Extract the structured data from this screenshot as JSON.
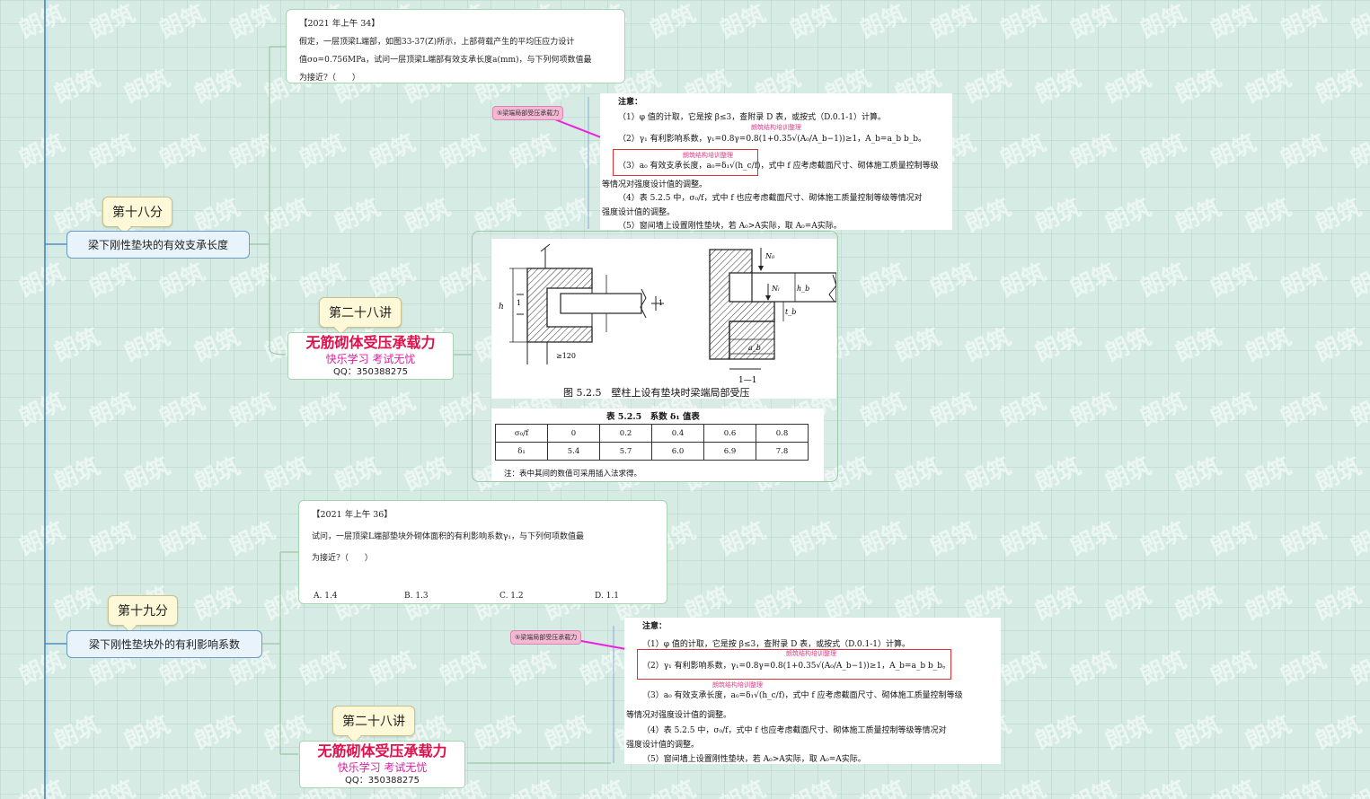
{
  "watermark": {
    "text": "朗筑"
  },
  "topics": [
    {
      "score_tag": "第十八分",
      "title": "梁下刚性垫块的有效支承长度",
      "question": {
        "header": "【2021 年上午 34】",
        "lines": [
          "假定，一层顶梁L端部，如图33-37(Z)所示，上部荷载产生的平均压应力设计",
          "值σo=0.756MPa，试问一层顶梁L端部有效支承长度a(mm)，与下列何项数值最",
          "为接近?（　　）"
        ],
        "options": []
      },
      "lecture": {
        "tag": "第二十八讲",
        "title": "无筋砌体受压承载力",
        "subtitle": "快乐学习  考试无忧",
        "qq": "QQ：350388275"
      },
      "link_tag": "⑤梁端局部受压承载力",
      "notes": {
        "heading": "注意：",
        "items": [
          "（1）φ 值的计取，它是按 β≤3，查附录 D 表，或按式（D.0.1-1）计算。",
          "（2）γ₁ 有利影响系数，γ₁=0.8γ=0.8(1+0.35√(A₀/A_b−1))≥1，A_b=a_b b_b。",
          "（3）a₀ 有效支承长度，a₀=δ₁√(h_c/f)，式中 f 应考虑截面尺寸、砌体施工质量控制等级",
          "等情况对强度设计值的调整。",
          "（4）表 5.2.5 中，σ₀/f，式中 f 也应考虑截面尺寸、砌体施工质量控制等级等情况对",
          "强度设计值的调整。",
          "（5）窗间墙上设置刚性垫块，若 A₀>A实际，取 A₀=A实际。"
        ],
        "stamp": "朗筑结构培训整理"
      }
    },
    {
      "score_tag": "第十九分",
      "title": "梁下刚性垫块外的有利影响系数",
      "question": {
        "header": "【2021 年上午 36】",
        "lines": [
          "试问，一层顶梁L端部垫块外砌体面积的有利影响系数γ₁，与下列何项数值最",
          "为接近?（　　）"
        ],
        "options": [
          "A. 1.4",
          "B. 1.3",
          "C. 1.2",
          "D. 1.1"
        ]
      },
      "lecture": {
        "tag": "第二十八讲",
        "title": "无筋砌体受压承载力",
        "subtitle": "快乐学习  考试无忧",
        "qq": "QQ：350388275"
      },
      "link_tag": "⑤梁端局部受压承载力",
      "notes": {
        "heading": "注意：",
        "items": [
          "（1）φ 值的计取，它是按 β≤3，查附录 D 表，或按式（D.0.1-1）计算。",
          "（2）γ₁ 有利影响系数，γ₁=0.8γ=0.8(1+0.35√(A₀/A_b−1))≥1，A_b=a_b b_b。",
          "（3）a₀ 有效支承长度，a₀=δ₁√(h_c/f)，式中 f 应考虑截面尺寸、砌体施工质量控制等级",
          "等情况对强度设计值的调整。",
          "（4）表 5.2.5 中，σ₀/f，式中 f 也应考虑截面尺寸、砌体施工质量控制等级等情况对",
          "强度设计值的调整。",
          "（5）窗间墙上设置刚性垫块，若 A₀>A实际，取 A₀=A实际。"
        ],
        "stamp": "朗筑结构培训整理"
      }
    }
  ],
  "figure": {
    "caption": "图 5.2.5　壁柱上设有垫块时梁端局部受压",
    "section_label": "1—1",
    "dims": {
      "h": "h",
      "ge120": "≥120",
      "one": "1",
      "N0": "N₀",
      "Nl": "Nₗ",
      "ab": "a_b",
      "tb": "t_b",
      "hb": "h_b"
    }
  },
  "coef_table": {
    "title": "表 5.2.5　系数 δ₁ 值表",
    "row_headers": [
      "σ₀/f",
      "δ₁"
    ],
    "sigma_ratio": [
      "0",
      "0.2",
      "0.4",
      "0.6",
      "0.8"
    ],
    "delta": [
      "5.4",
      "5.7",
      "6.0",
      "6.9",
      "7.8"
    ],
    "note": "注：表中其间的数值可采用插入法求得。"
  },
  "colors": {
    "accent_red": "#e0104c",
    "accent_magenta": "#d81ea0",
    "arrow": "#ee22dd",
    "box_red": "#e23030"
  }
}
